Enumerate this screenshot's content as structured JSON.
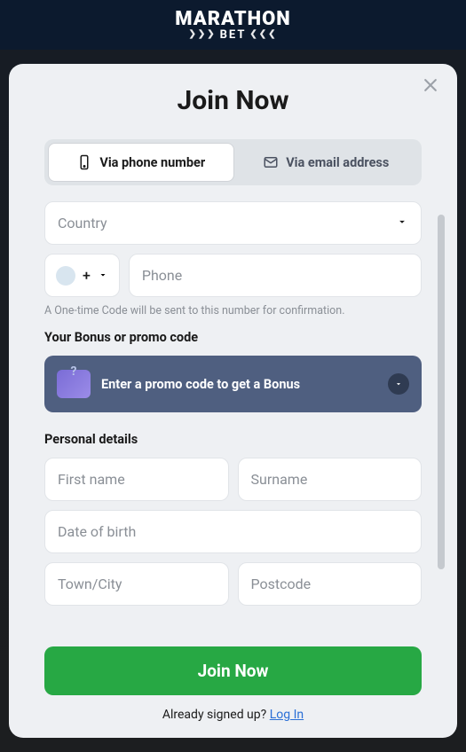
{
  "brand": {
    "name_top": "MARATHON",
    "name_bottom": "BET"
  },
  "modal": {
    "title": "Join Now",
    "tabs": {
      "phone": "Via phone number",
      "email": "Via email address"
    },
    "country_placeholder": "Country",
    "dial_plus": "+",
    "phone_placeholder": "Phone",
    "otp_hint": "A One-time Code will be sent to this number for confirmation.",
    "bonus_label": "Your Bonus or promo code",
    "promo_text": "Enter a promo code to get a Bonus",
    "personal_label": "Personal details",
    "fields": {
      "first_name": "First name",
      "surname": "Surname",
      "dob": "Date of birth",
      "town": "Town/City",
      "postcode": "Postcode"
    },
    "join_button": "Join Now",
    "already": "Already signed up? ",
    "login": "Log In"
  }
}
